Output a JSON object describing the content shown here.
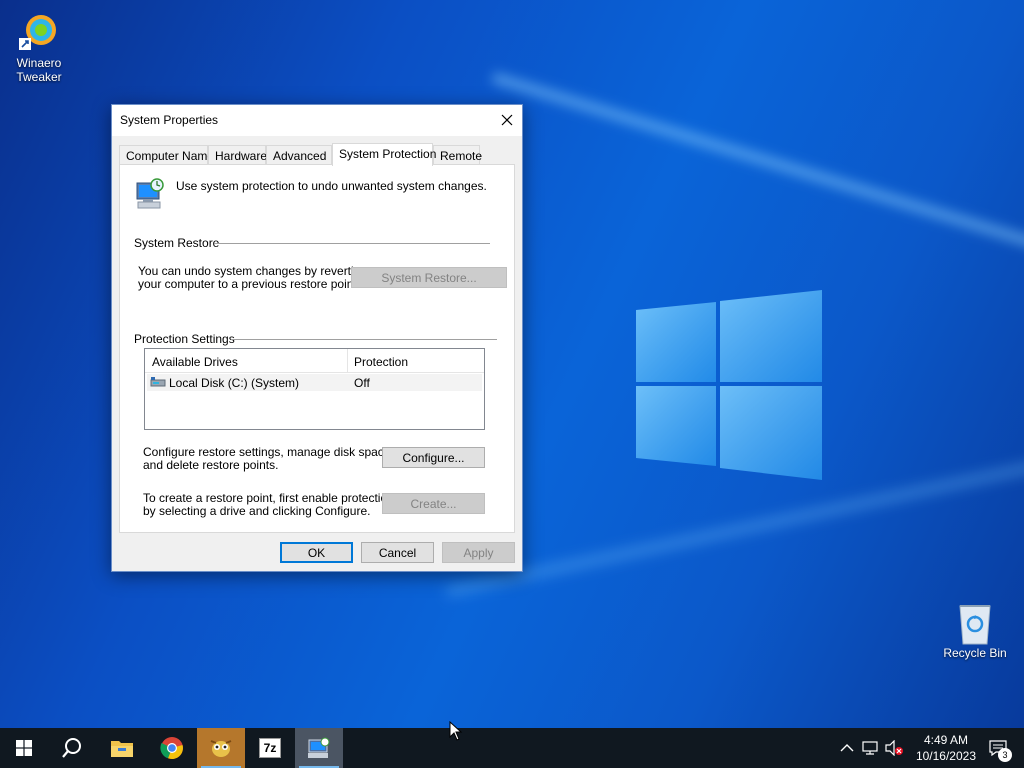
{
  "desktop": {
    "icons": [
      {
        "label_line1": "Winaero",
        "label_line2": "Tweaker"
      },
      {
        "label_line1": "Recycle Bin",
        "label_line2": ""
      }
    ]
  },
  "dialog": {
    "title": "System Properties",
    "tabs": [
      "Computer Name",
      "Hardware",
      "Advanced",
      "System Protection",
      "Remote"
    ],
    "active_tab": "System Protection",
    "intro_text": "Use system protection to undo unwanted system changes.",
    "system_restore": {
      "group_label": "System Restore",
      "description_line1": "You can undo system changes by reverting",
      "description_line2": "your computer to a previous restore point.",
      "button_label": "System Restore..."
    },
    "protection_settings": {
      "group_label": "Protection Settings",
      "columns": [
        "Available Drives",
        "Protection"
      ],
      "rows": [
        {
          "drive": "Local Disk (C:) (System)",
          "protection": "Off"
        }
      ],
      "configure_text_line1": "Configure restore settings, manage disk space,",
      "configure_text_line2": "and delete restore points.",
      "configure_button": "Configure...",
      "create_text_line1": "To create a restore point, first enable protection",
      "create_text_line2": "by selecting a drive and clicking Configure.",
      "create_button": "Create..."
    },
    "buttons": {
      "ok": "OK",
      "cancel": "Cancel",
      "apply": "Apply"
    }
  },
  "taskbar": {
    "pinned": [
      "start-icon",
      "search-icon",
      "file-explorer-icon",
      "chrome-icon",
      "winaero-tweaker-icon",
      "7zip-icon",
      "system-properties-icon"
    ],
    "clock_time": "4:49 AM",
    "clock_date": "10/16/2023",
    "notification_count": "3",
    "zip_label": "7z"
  },
  "colors": {
    "accent": "#0078d7",
    "desktop": "#0b5fd0",
    "taskbar": "#101820"
  }
}
